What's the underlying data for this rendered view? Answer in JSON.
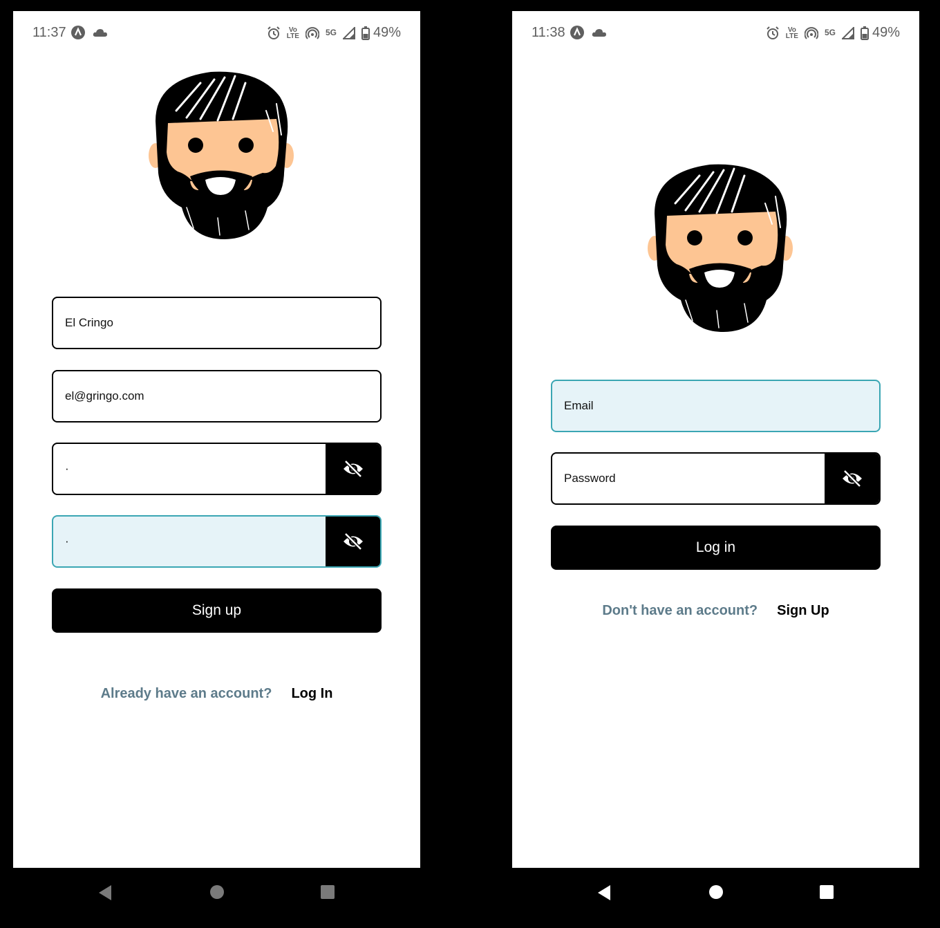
{
  "signup_screen": {
    "status": {
      "time": "11:37",
      "battery": "49%",
      "volte_top": "Vo",
      "volte_bottom": "LTE",
      "network": "5G"
    },
    "name_value": "El Cringo",
    "email_value": "el@gringo.com",
    "password_value": "·",
    "confirm_password_value": "·",
    "signup_button": "Sign up",
    "prompt_text": "Already have an account?",
    "login_link": "Log In",
    "icons": {
      "avatar": "bearded-man-avatar",
      "eye": "eye-slash-icon"
    }
  },
  "login_screen": {
    "status": {
      "time": "11:38",
      "battery": "49%",
      "volte_top": "Vo",
      "volte_bottom": "LTE",
      "network": "5G"
    },
    "email_placeholder": "Email",
    "password_placeholder": "Password",
    "login_button": "Log in",
    "prompt_text": "Don't have an account?",
    "signup_link": "Sign Up",
    "icons": {
      "avatar": "bearded-man-avatar",
      "eye": "eye-slash-icon"
    }
  },
  "colors": {
    "focus_border": "#3aa6b3",
    "focus_background": "#e6f3f8",
    "muted_link": "#5d7b8a",
    "skin": "#fdc593"
  }
}
